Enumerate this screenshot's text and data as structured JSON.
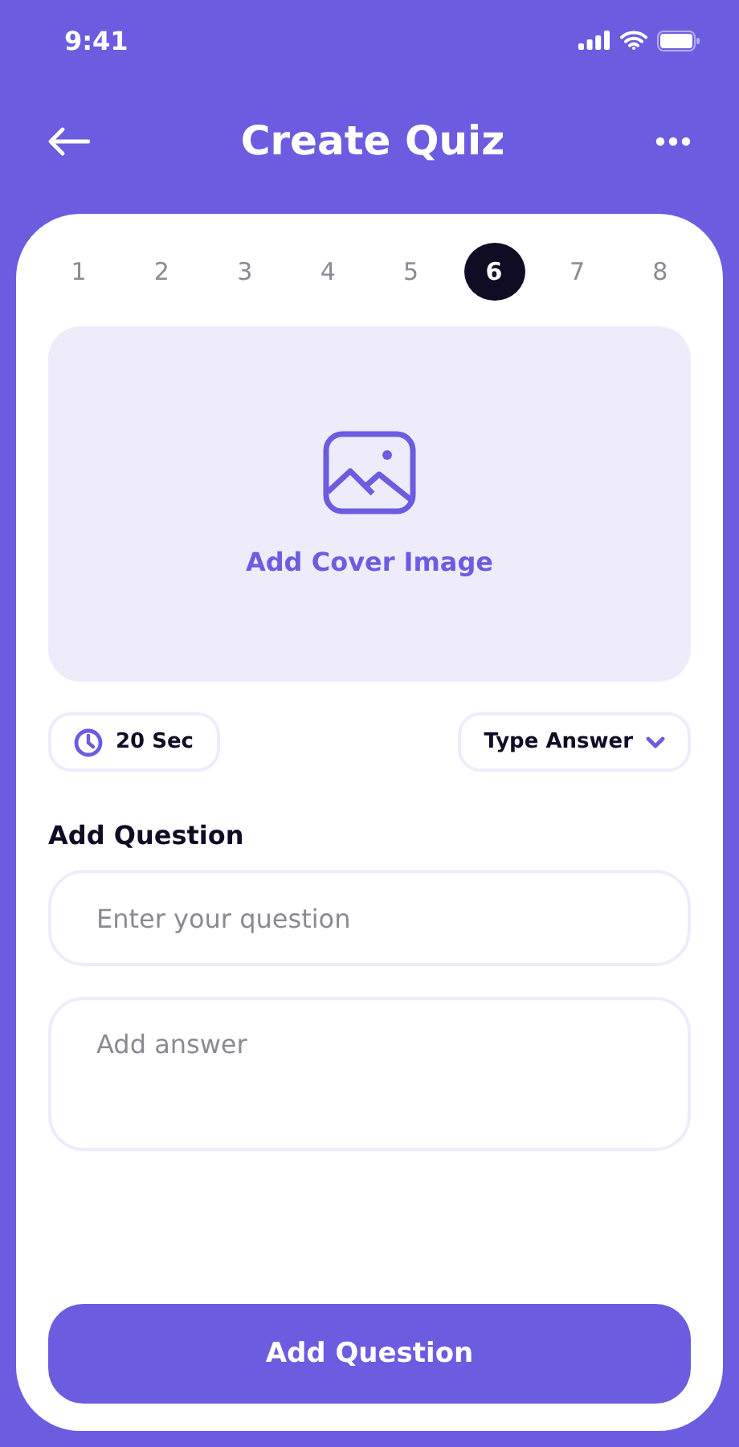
{
  "status_bar": {
    "time": "9:41"
  },
  "header": {
    "title": "Create Quiz"
  },
  "steps": [
    {
      "label": "1",
      "selected": false
    },
    {
      "label": "2",
      "selected": false
    },
    {
      "label": "3",
      "selected": false
    },
    {
      "label": "4",
      "selected": false
    },
    {
      "label": "5",
      "selected": false
    },
    {
      "label": "6",
      "selected": true
    },
    {
      "label": "7",
      "selected": false
    },
    {
      "label": "8",
      "selected": false
    }
  ],
  "cover": {
    "label": "Add Cover Image"
  },
  "timer": {
    "label": "20 Sec"
  },
  "answer_type": {
    "label": "Type Answer"
  },
  "section_title": "Add Question",
  "question_field": {
    "placeholder": "Enter your question"
  },
  "answer_field": {
    "placeholder": "Add answer"
  },
  "submit_button": "Add Question"
}
